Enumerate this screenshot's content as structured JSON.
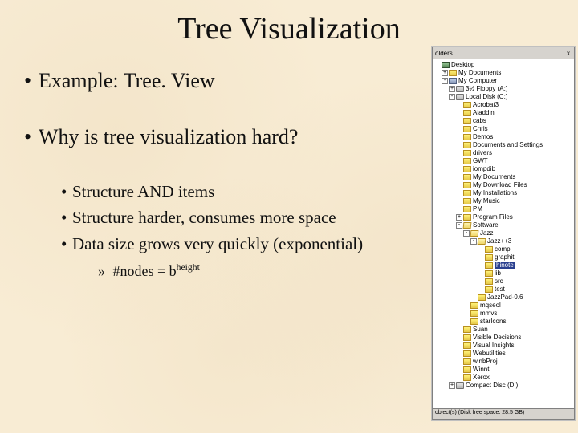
{
  "title": "Tree Visualization",
  "bullets": {
    "l1a": "Example:  Tree. View",
    "l1b": "Why is tree visualization hard?",
    "l2a": "Structure AND items",
    "l2b": "Structure harder, consumes more space",
    "l2c": "Data size grows very quickly (exponential)",
    "l3a_prefix": "#nodes = b",
    "l3a_sup": "height"
  },
  "treepanel": {
    "header": "olders",
    "close": "x",
    "footer": "object(s) (Disk free space: 28.5 GB)"
  },
  "tree": [
    {
      "d": 0,
      "pm": "",
      "ic": "desk",
      "t": "Desktop"
    },
    {
      "d": 1,
      "pm": "+",
      "ic": "fc",
      "t": "My Documents"
    },
    {
      "d": 1,
      "pm": "-",
      "ic": "pc",
      "t": "My Computer"
    },
    {
      "d": 2,
      "pm": "+",
      "ic": "disk",
      "t": "3½ Floppy (A:)"
    },
    {
      "d": 2,
      "pm": "-",
      "ic": "disk",
      "t": "Local Disk (C:)"
    },
    {
      "d": 3,
      "pm": "",
      "ic": "fc",
      "t": "Acrobat3"
    },
    {
      "d": 3,
      "pm": "",
      "ic": "fc",
      "t": "Aladdin"
    },
    {
      "d": 3,
      "pm": "",
      "ic": "fc",
      "t": "cabs"
    },
    {
      "d": 3,
      "pm": "",
      "ic": "fc",
      "t": "Chris"
    },
    {
      "d": 3,
      "pm": "",
      "ic": "fc",
      "t": "Demos"
    },
    {
      "d": 3,
      "pm": "",
      "ic": "fc",
      "t": "Documents and Settings"
    },
    {
      "d": 3,
      "pm": "",
      "ic": "fc",
      "t": "drivers"
    },
    {
      "d": 3,
      "pm": "",
      "ic": "fc",
      "t": "GWT"
    },
    {
      "d": 3,
      "pm": "",
      "ic": "fc",
      "t": "iompdib"
    },
    {
      "d": 3,
      "pm": "",
      "ic": "fc",
      "t": "My Documents"
    },
    {
      "d": 3,
      "pm": "",
      "ic": "fc",
      "t": "My Download Files"
    },
    {
      "d": 3,
      "pm": "",
      "ic": "fc",
      "t": "My Installations"
    },
    {
      "d": 3,
      "pm": "",
      "ic": "fc",
      "t": "My Music"
    },
    {
      "d": 3,
      "pm": "",
      "ic": "fc",
      "t": "PM"
    },
    {
      "d": 3,
      "pm": "+",
      "ic": "fc",
      "t": "Program Files"
    },
    {
      "d": 3,
      "pm": "-",
      "ic": "fo",
      "t": "Software"
    },
    {
      "d": 4,
      "pm": "-",
      "ic": "fo",
      "t": "Jazz"
    },
    {
      "d": 5,
      "pm": "-",
      "ic": "fo",
      "t": "Jazz++3"
    },
    {
      "d": 6,
      "pm": "",
      "ic": "fc",
      "t": "comp"
    },
    {
      "d": 6,
      "pm": "",
      "ic": "fc",
      "t": "graphit"
    },
    {
      "d": 6,
      "pm": "",
      "ic": "fc",
      "t": "hinote",
      "sel": true
    },
    {
      "d": 6,
      "pm": "",
      "ic": "fc",
      "t": "lib"
    },
    {
      "d": 6,
      "pm": "",
      "ic": "fc",
      "t": "src"
    },
    {
      "d": 6,
      "pm": "",
      "ic": "fc",
      "t": "test"
    },
    {
      "d": 5,
      "pm": "",
      "ic": "fc",
      "t": "JazzPad-0.6"
    },
    {
      "d": 4,
      "pm": "",
      "ic": "fc",
      "t": "mqseol"
    },
    {
      "d": 4,
      "pm": "",
      "ic": "fc",
      "t": "mmvs"
    },
    {
      "d": 4,
      "pm": "",
      "ic": "fc",
      "t": "starIcons"
    },
    {
      "d": 3,
      "pm": "",
      "ic": "fc",
      "t": "Suan"
    },
    {
      "d": 3,
      "pm": "",
      "ic": "fc",
      "t": "Visible Decisions"
    },
    {
      "d": 3,
      "pm": "",
      "ic": "fc",
      "t": "Visual Insights"
    },
    {
      "d": 3,
      "pm": "",
      "ic": "fc",
      "t": "Webutilities"
    },
    {
      "d": 3,
      "pm": "",
      "ic": "fc",
      "t": "winbProj"
    },
    {
      "d": 3,
      "pm": "",
      "ic": "fc",
      "t": "Winnt"
    },
    {
      "d": 3,
      "pm": "",
      "ic": "fc",
      "t": "Xerox"
    },
    {
      "d": 2,
      "pm": "+",
      "ic": "disk",
      "t": "Compact Disc (D:)"
    }
  ]
}
